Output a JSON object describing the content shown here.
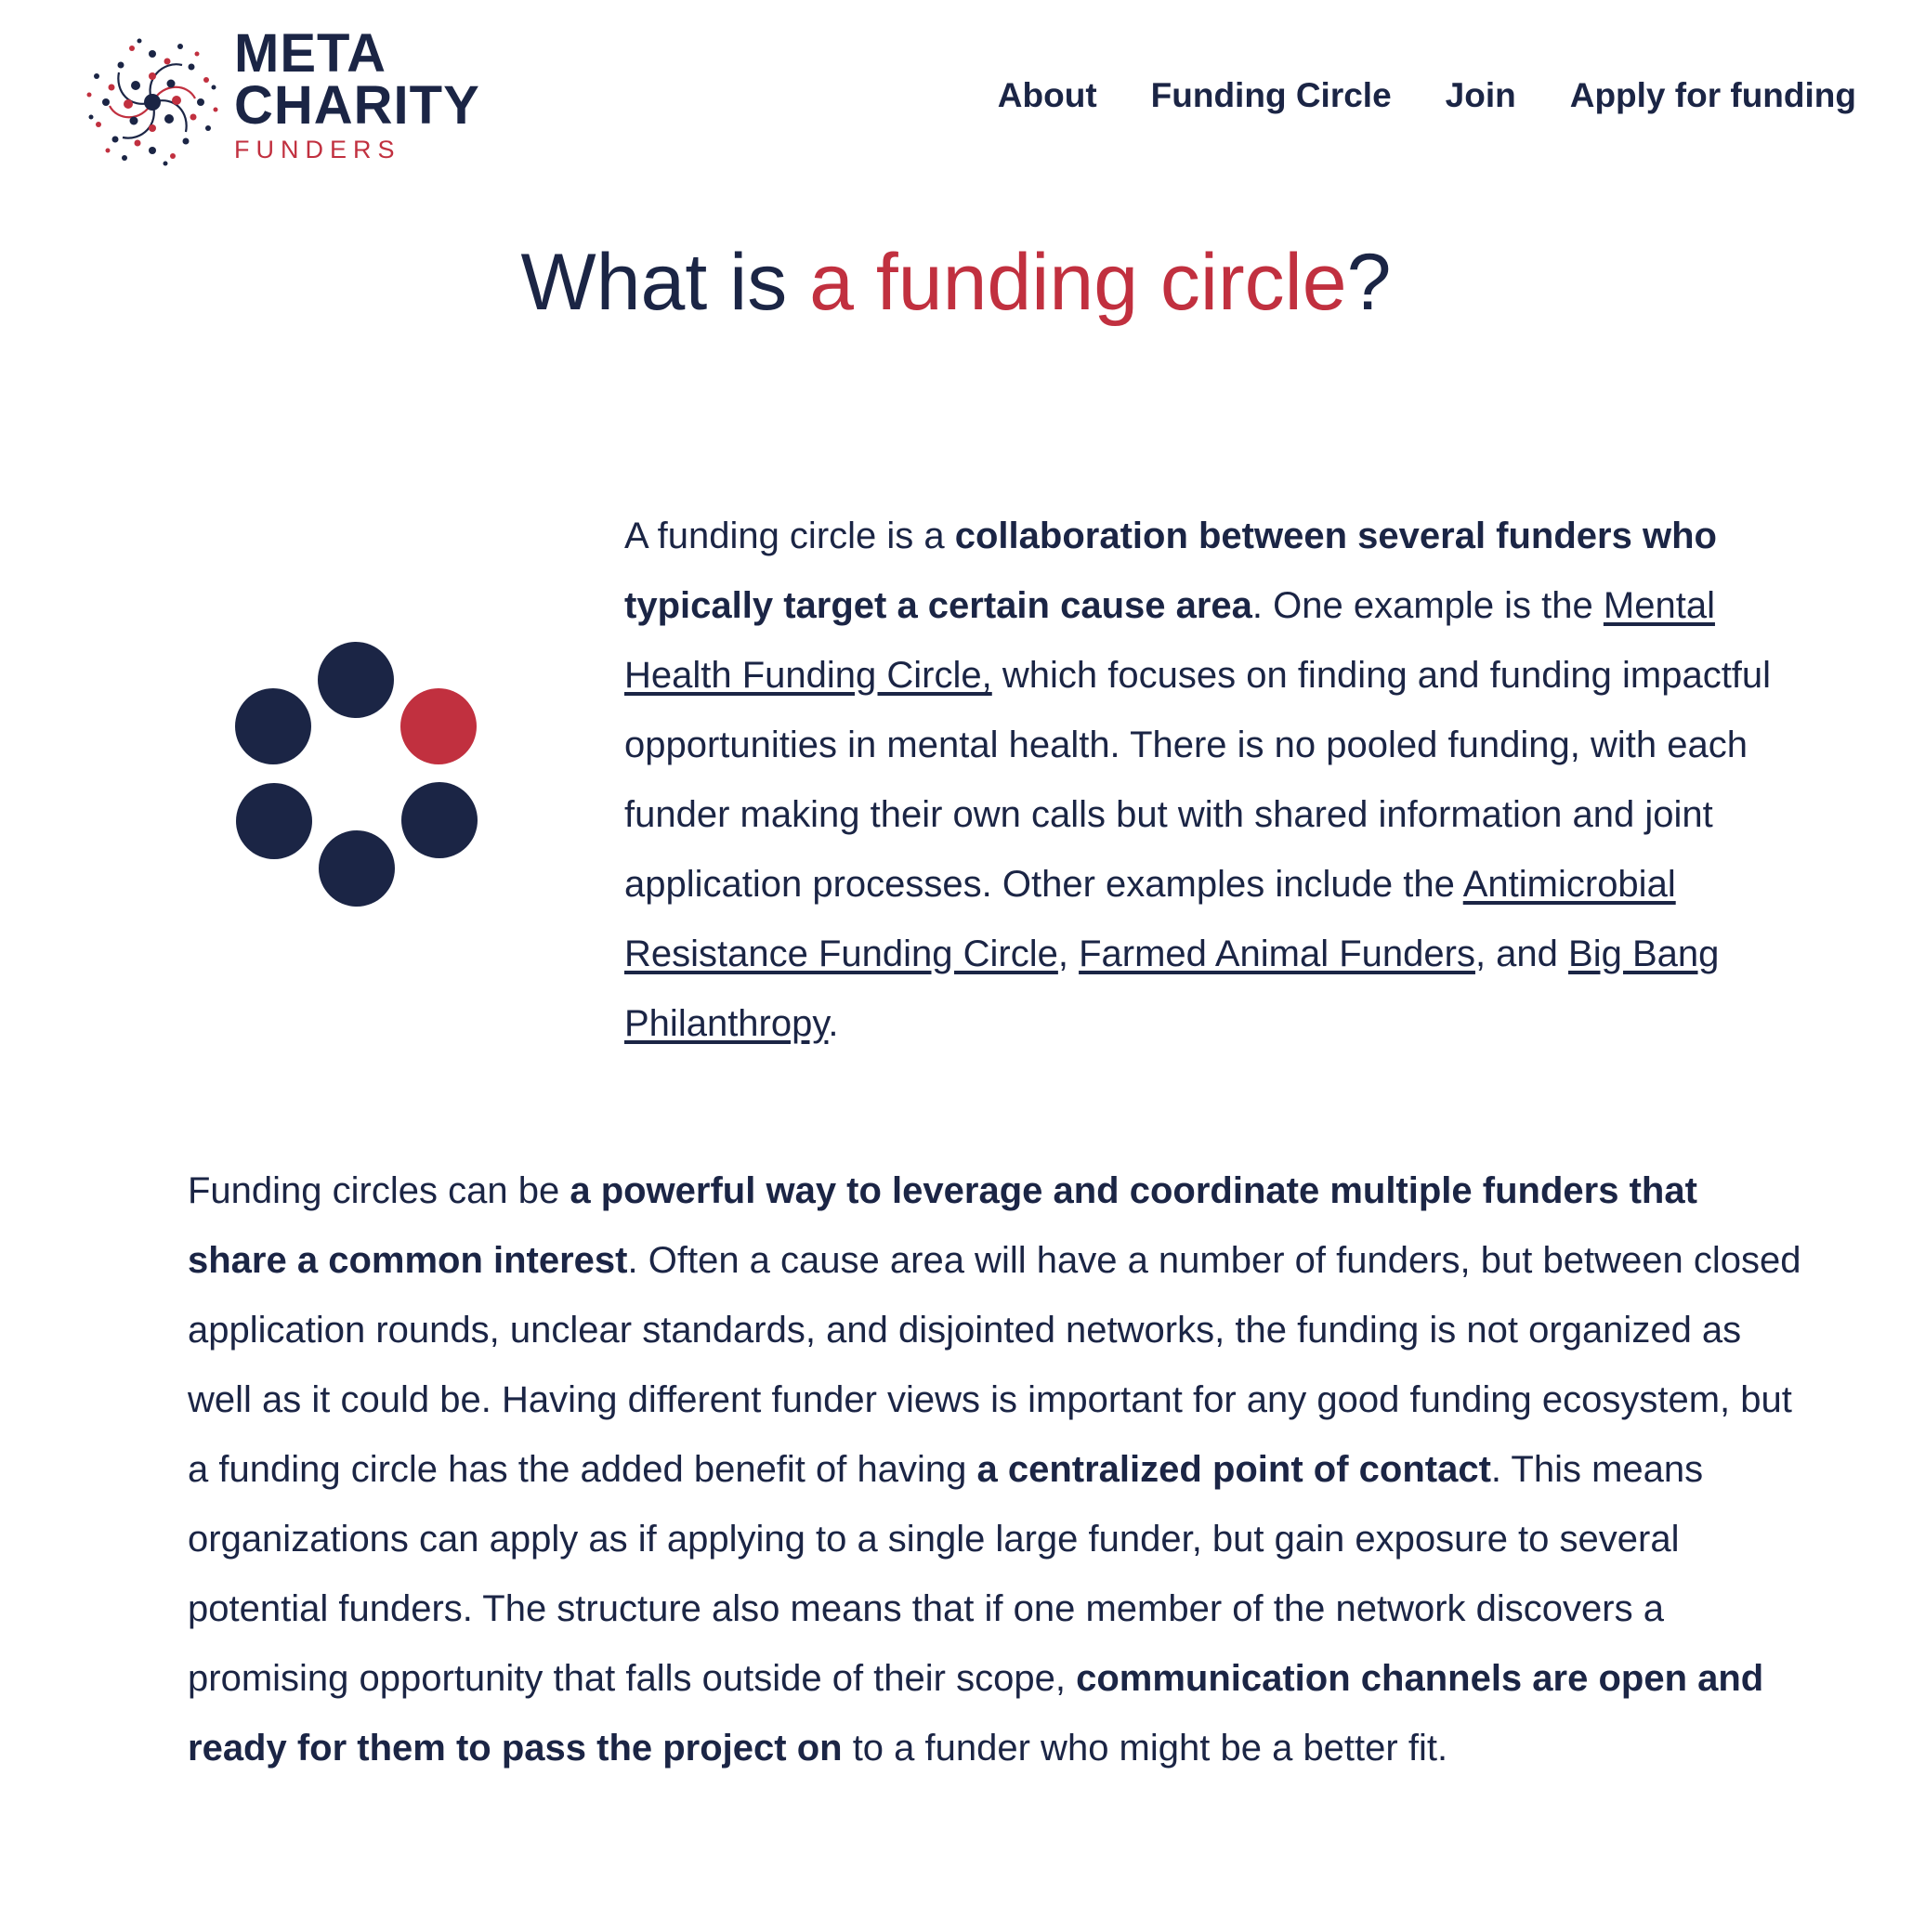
{
  "brand": {
    "line1": "META",
    "line2": "CHARITY",
    "line3": "FUNDERS",
    "colors": {
      "navy": "#1b2545",
      "red": "#c1303f"
    }
  },
  "nav": {
    "about": "About",
    "funding_circle": "Funding Circle",
    "join": "Join",
    "apply": "Apply for funding"
  },
  "title": {
    "part1": "What is ",
    "accent": "a funding circle",
    "part2": "?"
  },
  "intro": {
    "t1": "A funding circle is a ",
    "b1": "collaboration between several funders who typically target a certain cause area",
    "t2": ". One example is the ",
    "link1": "Mental Health Funding Circle,",
    "t3": " which focuses on finding and funding impactful opportunities in mental health. There is no pooled funding, with each funder making their own calls but with shared information and joint application processes. Other examples include the ",
    "link2": "Antimicrobial Resistance Funding Circle",
    "t4": ", ",
    "link3": "Farmed Animal Funders",
    "t5": ", and ",
    "link4": "Big Bang Philanthropy",
    "t6": "."
  },
  "body": {
    "t1": "Funding circles can be ",
    "b1": "a powerful way to leverage and coordinate multiple funders that share a common interest",
    "t2": ". Often a cause area will have a number of funders, but between closed application rounds, unclear standards, and disjointed networks, the funding is not organized as well as it could be. Having different funder views is important for any good funding ecosystem, but a funding circle has the added benefit of having ",
    "b2": "a centralized point of contact",
    "t3": ". This means organizations can apply as if applying to a single large funder, but gain exposure to several potential funders. The structure also means that if one member of the network discovers a promising opportunity that falls outside of their scope, ",
    "b3": "communication channels are open and ready for them to pass the project on",
    "t4": " to a funder who might be a better fit."
  },
  "icons": {
    "logo": "meta-charity-funders-dots-logo",
    "circle_graphic": "funding-circle-dots-icon"
  }
}
